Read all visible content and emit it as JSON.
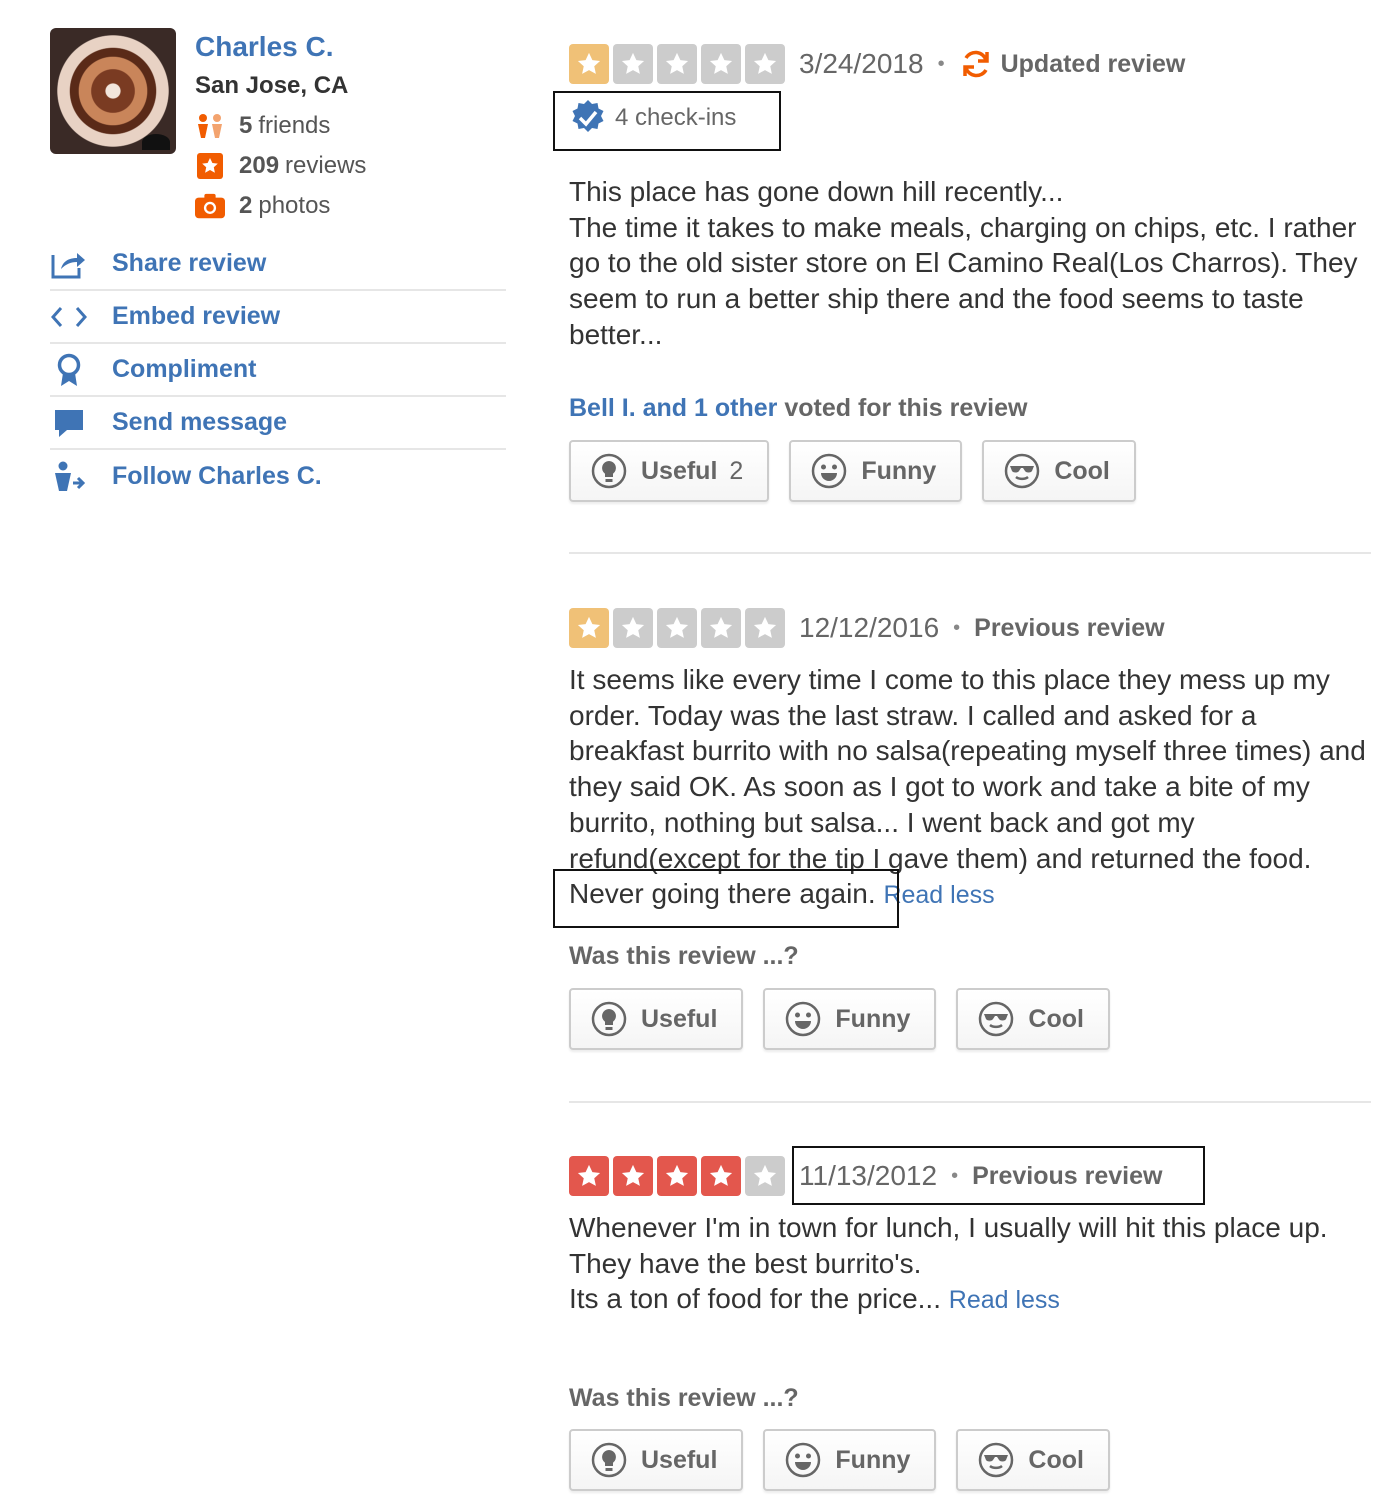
{
  "user": {
    "name": "Charles C.",
    "location": "San Jose, CA",
    "friends_count": "5",
    "friends_label": "friends",
    "reviews_count": "209",
    "reviews_label": "reviews",
    "photos_count": "2",
    "photos_label": "photos"
  },
  "actions": [
    {
      "label": "Share review",
      "icon": "share-icon"
    },
    {
      "label": "Embed review",
      "icon": "embed-icon"
    },
    {
      "label": "Compliment",
      "icon": "compliment-icon"
    },
    {
      "label": "Send message",
      "icon": "message-icon"
    },
    {
      "label": "Follow Charles C.",
      "icon": "follow-icon"
    }
  ],
  "colors": {
    "link": "#3f74b5",
    "star_one": "#f0c177",
    "star_four": "#e3574d",
    "star_empty": "#cccccc",
    "accent_orange": "#f15c00"
  },
  "reviews": [
    {
      "rating": 1,
      "date": "3/24/2018",
      "status": "Updated review",
      "checkins": "4 check-ins",
      "text": "This place has gone down hill recently...\nThe time it takes to make meals, charging on chips, etc. I rather go to the old sister store on El Camino Real(Los Charros).  They seem to run a better ship there and the food seems to taste better...",
      "voted_names": "Bell I. and 1 other",
      "voted_suffix": "voted for this review",
      "buttons": {
        "useful": "Useful",
        "useful_count": "2",
        "funny": "Funny",
        "cool": "Cool"
      }
    },
    {
      "rating": 1,
      "date": "12/12/2016",
      "status": "Previous review",
      "text": "It seems like every time I come to this place they mess up my order. Today was the last straw. I called and asked for a breakfast burrito with no salsa(repeating myself three times) and they said OK.  As soon as I got to work and take a bite of my burrito, nothing but salsa... I went back and got my refund(except for the tip I gave them) and returned the food. Never going there again.",
      "read_less": "Read less",
      "question": "Was this review ...?",
      "buttons": {
        "useful": "Useful",
        "funny": "Funny",
        "cool": "Cool"
      }
    },
    {
      "rating": 4,
      "date": "11/13/2012",
      "status": "Previous review",
      "text": "Whenever I'm in town for lunch, I usually will hit this place up.\nThey have the best burrito's.\nIts a ton of food for the price...",
      "read_less": "Read less",
      "question": "Was this review ...?",
      "buttons": {
        "useful": "Useful",
        "funny": "Funny",
        "cool": "Cool"
      }
    }
  ]
}
